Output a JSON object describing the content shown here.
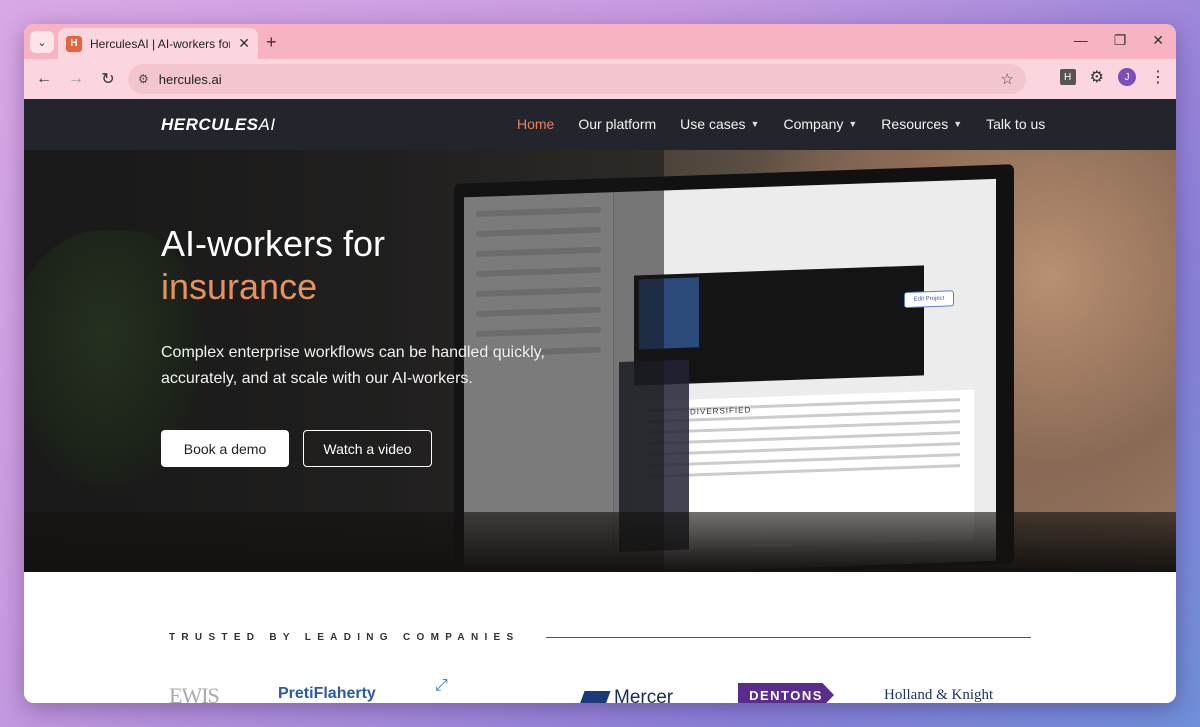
{
  "browser": {
    "tab_title": "HerculesAI | AI-workers for com",
    "favicon_text": "H",
    "new_tab": "+",
    "url": "hercules.ai",
    "extension_letter": "H",
    "profile_initial": "J",
    "icons": [
      "tab-list",
      "close",
      "minimize",
      "restore",
      "back",
      "forward",
      "reload",
      "site-settings",
      "star",
      "puzzle",
      "menu-kebab"
    ]
  },
  "site": {
    "logo_main": "HERCULES",
    "logo_ai": "AI",
    "nav": [
      {
        "label": "Home",
        "active": true,
        "dropdown": false
      },
      {
        "label": "Our platform",
        "active": false,
        "dropdown": false
      },
      {
        "label": "Use cases",
        "active": false,
        "dropdown": true
      },
      {
        "label": "Company",
        "active": false,
        "dropdown": true
      },
      {
        "label": "Resources",
        "active": false,
        "dropdown": true
      },
      {
        "label": "Talk to us",
        "active": false,
        "dropdown": false
      }
    ],
    "accent_color": "#e8825a"
  },
  "hero": {
    "title_line1": "AI-workers for",
    "title_line2": "insurance",
    "subtitle": "Complex enterprise workflows can be handled quickly, accurately, and at scale with our AI-workers.",
    "primary_cta": "Book a demo",
    "secondary_cta": "Watch a video",
    "screen_edit_label": "Edit Project",
    "screen_heading": "DIVERSIFIED"
  },
  "trusted": {
    "label": "TRUSTED BY LEADING COMPANIES",
    "logos": {
      "lewis": "EWIS",
      "preti": "PretiFlaherty",
      "mercer": "Mercer",
      "dentons": "DENTONS",
      "holland": "Holland & Knight"
    }
  }
}
